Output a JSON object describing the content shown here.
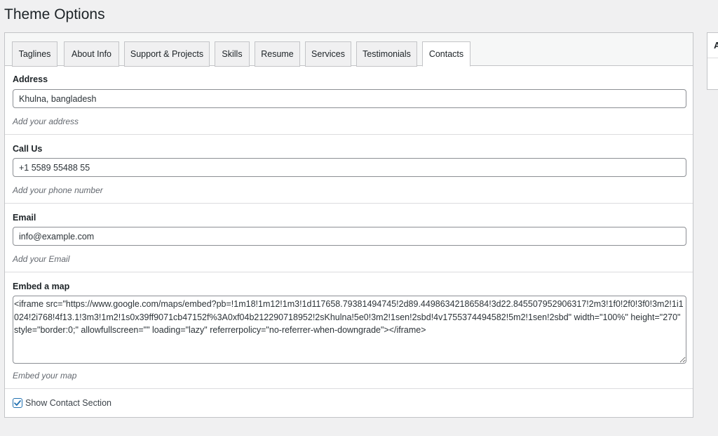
{
  "page": {
    "title": "Theme Options"
  },
  "tabs": [
    {
      "label": "Taglines"
    },
    {
      "label": "About Info"
    },
    {
      "label": "Support & Projects"
    },
    {
      "label": "Skills"
    },
    {
      "label": "Resume"
    },
    {
      "label": "Services"
    },
    {
      "label": "Testimonials"
    },
    {
      "label": "Contacts",
      "active": true
    }
  ],
  "fields": {
    "address": {
      "label": "Address",
      "value": "Khulna, bangladesh",
      "help": "Add your address"
    },
    "call_us": {
      "label": "Call Us",
      "value": "+1 5589 55488 55",
      "help": "Add your phone number"
    },
    "email": {
      "label": "Email",
      "value": "info@example.com",
      "help": "Add your Email"
    },
    "map": {
      "label": "Embed a map",
      "value": "<iframe src=\"https://www.google.com/maps/embed?pb=!1m18!1m12!1m3!1d117658.79381494745!2d89.44986342186584!3d22.845507952906317!2m3!1f0!2f0!3f0!3m2!1i1024!2i768!4f13.1!3m3!1m2!1s0x39ff9071cb47152f%3A0xf04b212290718952!2sKhulna!5e0!3m2!1sen!2sbd!4v1755374494582!5m2!1sen!2sbd\" width=\"100%\" height=\"270\" style=\"border:0;\" allowfullscreen=\"\" loading=\"lazy\" referrerpolicy=\"no-referrer-when-downgrade\"></iframe>",
      "help": "Embed your map"
    }
  },
  "show_contact": {
    "label": "Show Contact Section",
    "checked": true
  },
  "side_box": {
    "heading": "A"
  },
  "colors": {
    "accent": "#2271b1",
    "border": "#c3c4c7",
    "background": "#f0f0f1"
  }
}
